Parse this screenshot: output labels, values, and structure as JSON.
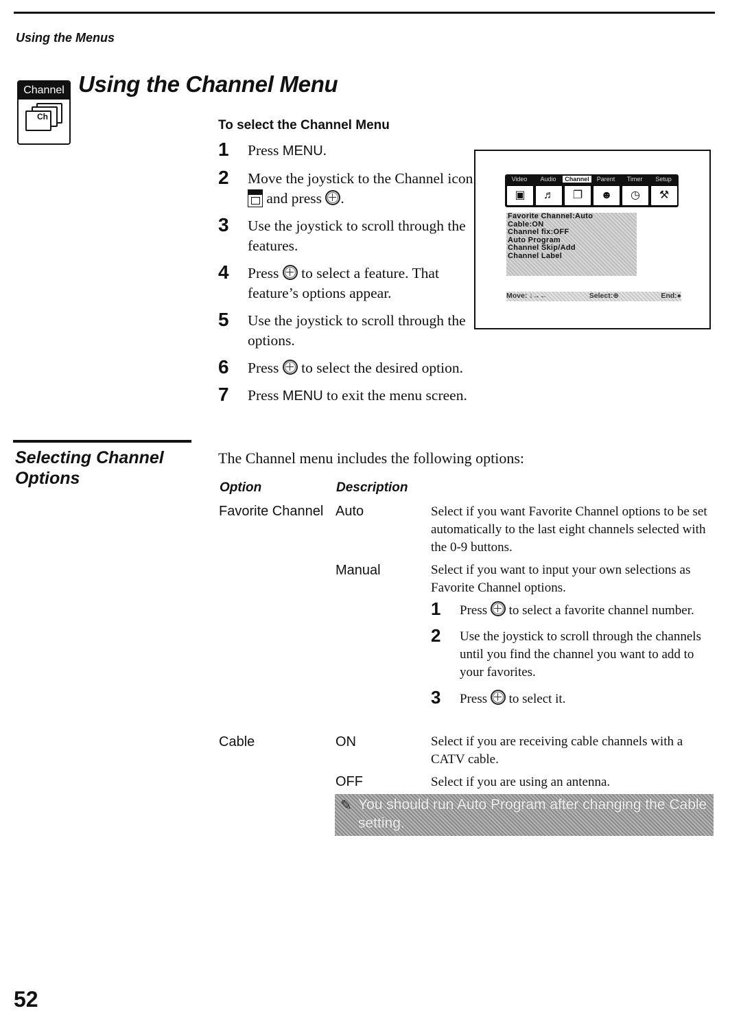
{
  "header": {
    "section_label": "Using the Menus"
  },
  "badge": {
    "label": "Channel",
    "card_text": "Ch",
    "icon": "channel-icon"
  },
  "title": "Using the Channel Menu",
  "select_menu": {
    "heading": "To select the Channel Menu",
    "steps": [
      {
        "num": "1",
        "parts": [
          "Press ",
          "MENU",
          "."
        ]
      },
      {
        "num": "2",
        "parts": [
          "Move the joystick to the Channel icon ",
          " and press ",
          "."
        ]
      },
      {
        "num": "3",
        "text": "Use the joystick to scroll through the features."
      },
      {
        "num": "4",
        "parts": [
          "Press ",
          " to select a feature. That feature’s options appear."
        ]
      },
      {
        "num": "5",
        "text": "Use the joystick to scroll through the options."
      },
      {
        "num": "6",
        "parts": [
          "Press ",
          " to select the desired option."
        ]
      },
      {
        "num": "7",
        "parts": [
          "Press ",
          "MENU",
          " to exit the menu screen."
        ]
      }
    ]
  },
  "tv_screen": {
    "tabs": [
      {
        "label": "Video",
        "icon": "video-icon"
      },
      {
        "label": "Audio",
        "icon": "audio-icon"
      },
      {
        "label": "Channel",
        "icon": "channel-icon",
        "active": true
      },
      {
        "label": "Parent",
        "icon": "parent-icon"
      },
      {
        "label": "Timer",
        "icon": "clock-icon"
      },
      {
        "label": "Setup",
        "icon": "toolbox-icon"
      }
    ],
    "menu_items": [
      "Favorite Channel:Auto",
      "Cable:ON",
      "Channel fix:OFF",
      "Auto Program",
      "Channel Skip/Add",
      "Channel Label"
    ],
    "footer": {
      "move": "Move: ↓→←",
      "select": "Select:⊕",
      "end": "End:●"
    }
  },
  "options_section": {
    "heading": "Selecting Channel Options",
    "intro": "The Channel menu includes the following options:",
    "col_option": "Option",
    "col_description": "Description",
    "rows": [
      {
        "option": "Favorite Channel",
        "value": "Auto",
        "description": "Select if you want Favorite Channel options to be set automatically to the last eight channels selected with the 0-9 buttons."
      },
      {
        "option": "",
        "value": "Manual",
        "description": "Select if you want to input your own selections as Favorite Channel options."
      },
      {
        "option": "Cable",
        "value": "ON",
        "description": "Select if you are receiving cable channels with a CATV cable."
      },
      {
        "option": "",
        "value": "OFF",
        "description": "Select if you are using an antenna."
      }
    ],
    "manual_steps": [
      {
        "num": "1",
        "parts": [
          "Press ",
          " to select a favorite channel number."
        ]
      },
      {
        "num": "2",
        "text": "Use the joystick to scroll through the channels until you find the channel you want to add to your favorites."
      },
      {
        "num": "3",
        "parts": [
          "Press ",
          " to select it."
        ]
      }
    ],
    "note": "You should run Auto Program after changing the Cable setting."
  },
  "page_number": "52"
}
